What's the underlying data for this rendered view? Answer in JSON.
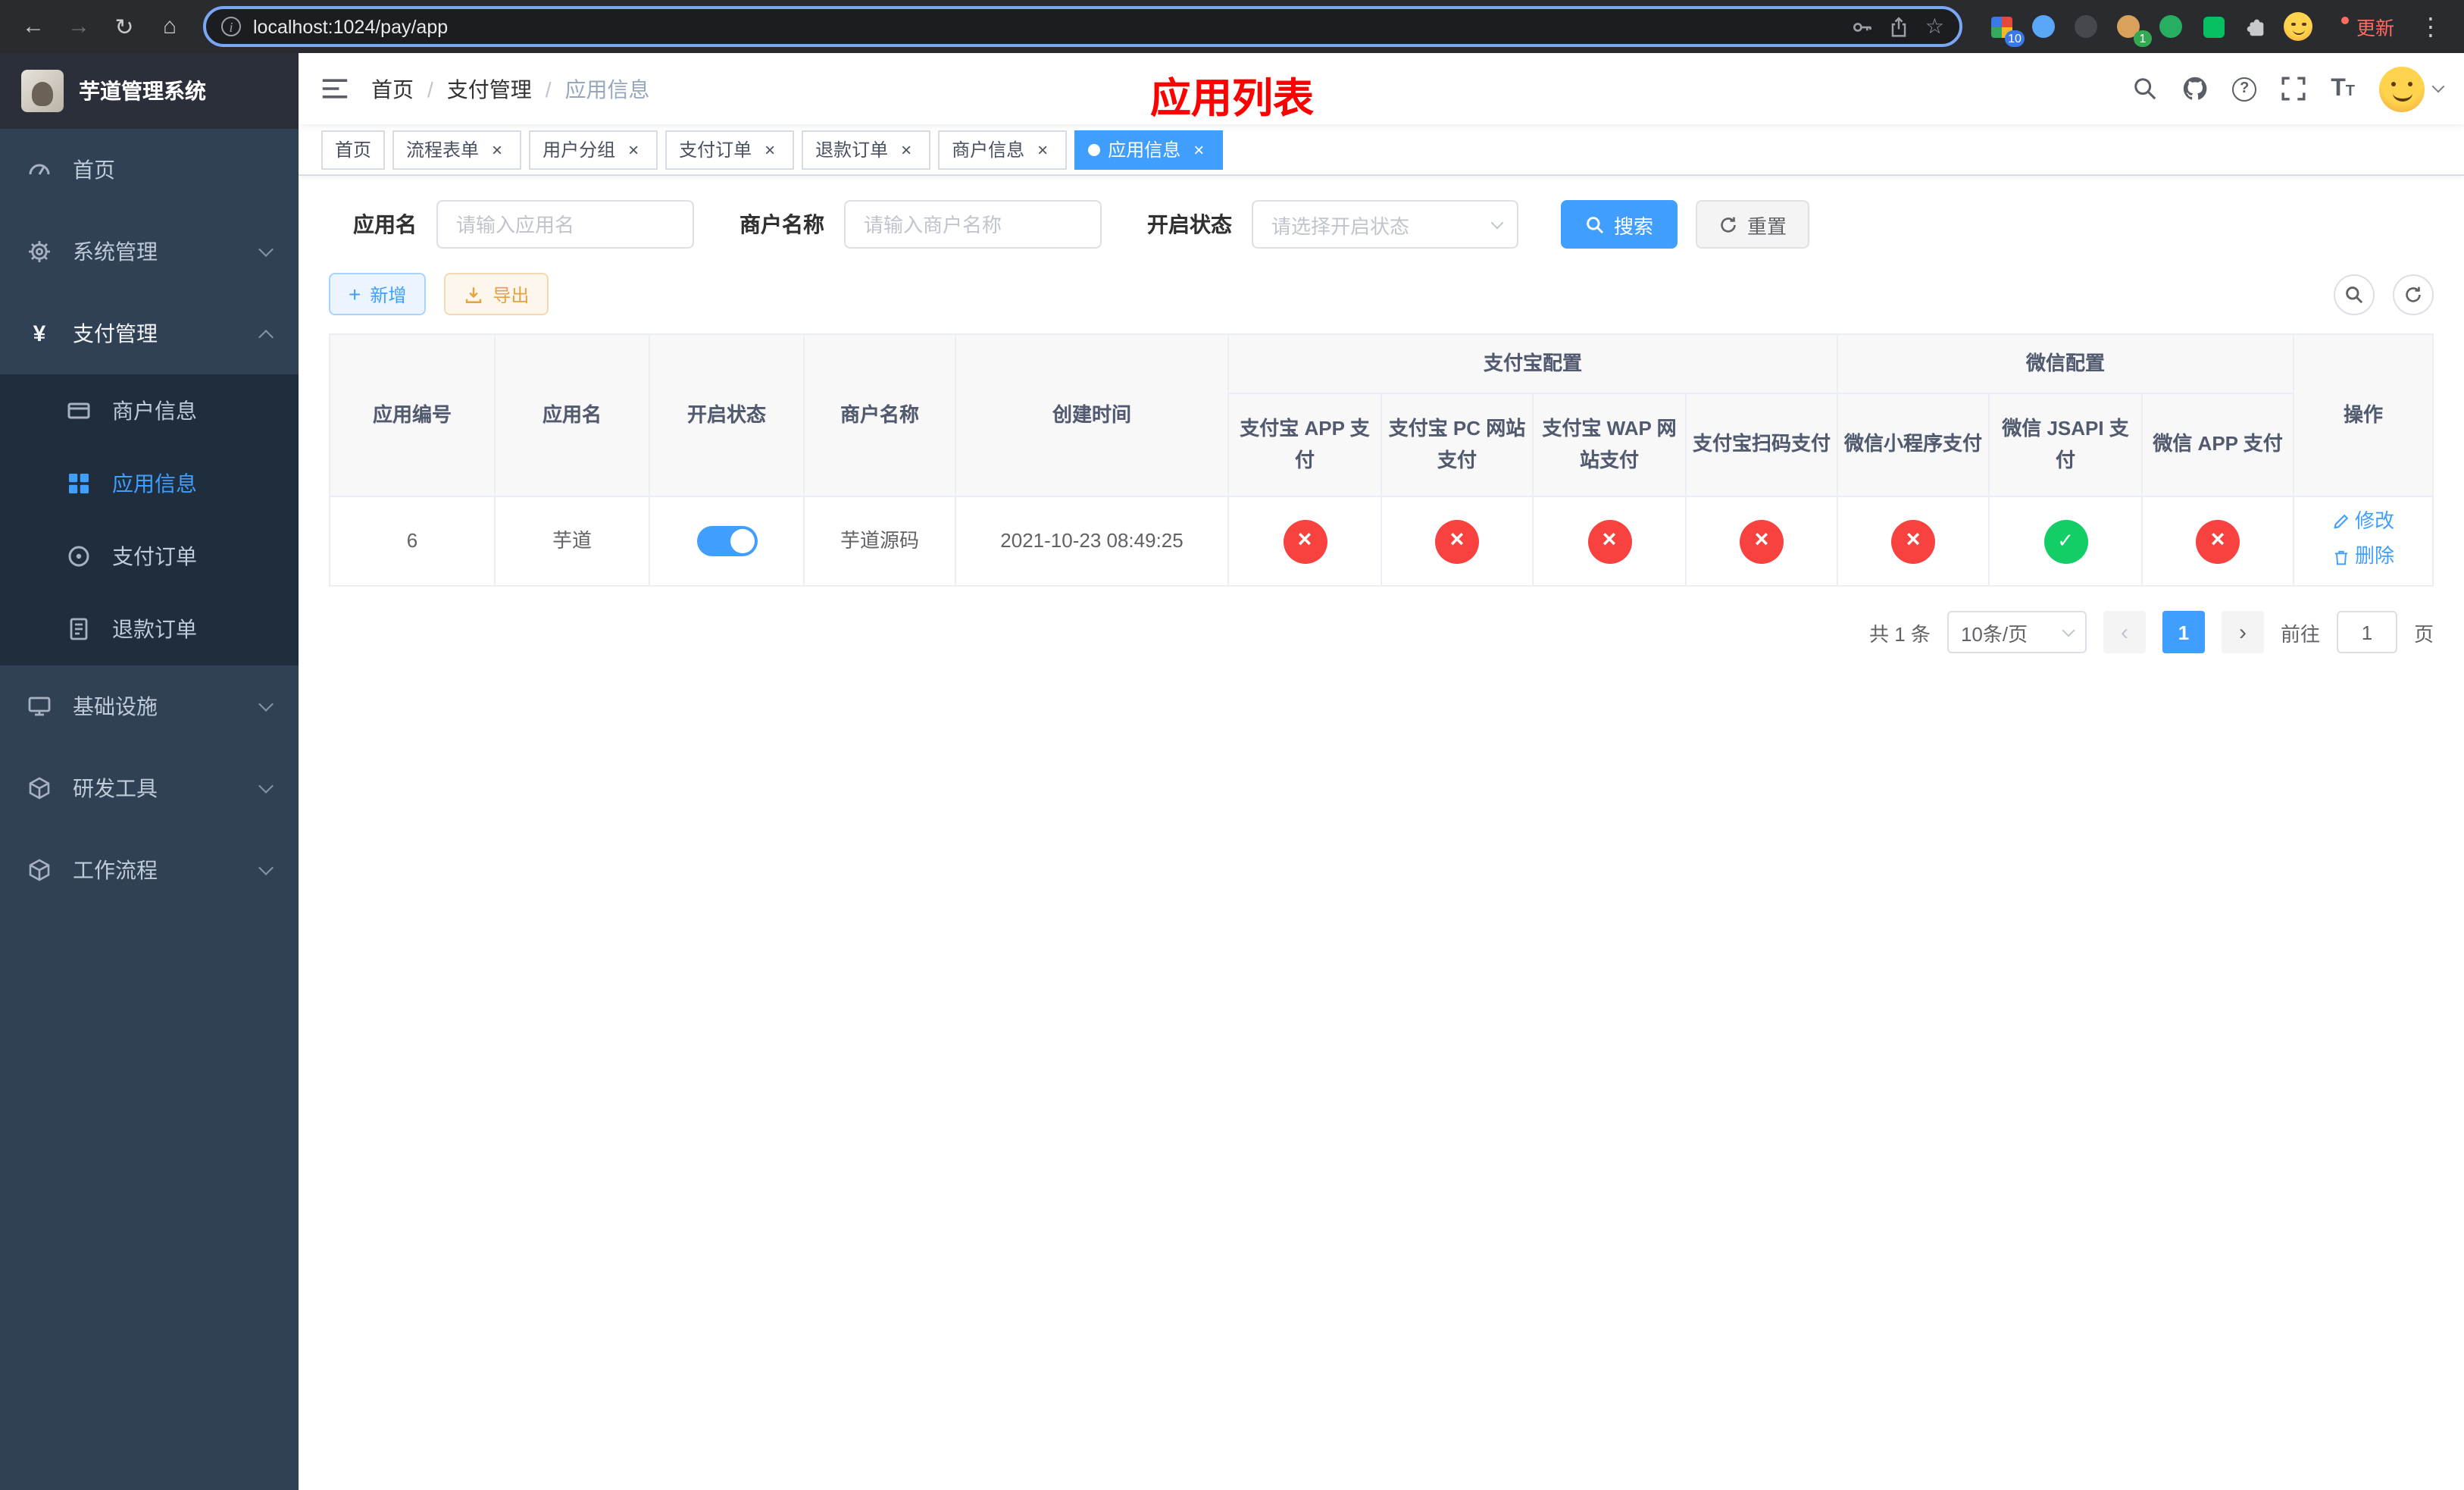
{
  "colors": {
    "accent": "#409eff",
    "danger": "#f8423f",
    "success": "#13ce66",
    "page_title": "#ff0000",
    "sidebar_bg": "#304156",
    "submenu_bg": "#1f2d3d"
  },
  "browser": {
    "url": "localhost:1024/pay/app",
    "update_label": "更新",
    "extensions_badge": "10",
    "profile_badge": "1"
  },
  "sidebar": {
    "logo_title": "芋道管理系统",
    "items": [
      {
        "label": "首页",
        "icon": "dashboard-icon"
      },
      {
        "label": "系统管理",
        "icon": "gear-icon"
      },
      {
        "label": "支付管理",
        "icon": "yen-icon"
      },
      {
        "label": "商户信息",
        "icon": "credit-card-icon"
      },
      {
        "label": "应用信息",
        "icon": "app-grid-icon"
      },
      {
        "label": "支付订单",
        "icon": "order-icon"
      },
      {
        "label": "退款订单",
        "icon": "refund-doc-icon"
      },
      {
        "label": "基础设施",
        "icon": "monitor-icon"
      },
      {
        "label": "研发工具",
        "icon": "cube-icon"
      },
      {
        "label": "工作流程",
        "icon": "cube-icon"
      }
    ]
  },
  "header": {
    "breadcrumb": [
      "首页",
      "支付管理",
      "应用信息"
    ],
    "separator": "/",
    "page_title": "应用列表",
    "action_icons": [
      "search-icon",
      "github-icon",
      "help-icon",
      "fullscreen-icon",
      "font-size-icon",
      "user-avatar"
    ]
  },
  "tabs": [
    {
      "label": "首页"
    },
    {
      "label": "流程表单"
    },
    {
      "label": "用户分组"
    },
    {
      "label": "支付订单"
    },
    {
      "label": "退款订单"
    },
    {
      "label": "商户信息"
    },
    {
      "label": "应用信息"
    }
  ],
  "filters": {
    "app_name_label": "应用名",
    "app_name_placeholder": "请输入应用名",
    "merchant_label": "商户名称",
    "merchant_placeholder": "请输入商户名称",
    "status_label": "开启状态",
    "status_placeholder": "请选择开启状态",
    "search_label": "搜索",
    "reset_label": "重置"
  },
  "toolbar": {
    "add_label": "新增",
    "add_icon": "plus-icon",
    "export_label": "导出",
    "export_icon": "download-icon"
  },
  "table": {
    "headers": {
      "app_id": "应用编号",
      "app_name": "应用名",
      "status": "开启状态",
      "merchant_name": "商户名称",
      "created_at": "创建时间",
      "alipay_group": "支付宝配置",
      "wechat_group": "微信配置",
      "alipay_cols": [
        "支付宝 APP 支付",
        "支付宝 PC 网站支付",
        "支付宝 WAP 网站支付",
        "支付宝扫码支付"
      ],
      "wechat_cols": [
        "微信小程序支付",
        "微信 JSAPI 支付",
        "微信 APP 支付"
      ],
      "actions": "操作"
    },
    "rows": [
      {
        "app_id": "6",
        "app_name": "芋道",
        "status_on": true,
        "merchant_name": "芋道源码",
        "created_at": "2021-10-23 08:49:25",
        "alipay": [
          false,
          false,
          false,
          false
        ],
        "wechat": [
          false,
          true,
          false
        ],
        "edit_label": "修改",
        "delete_label": "删除"
      }
    ]
  },
  "pagination": {
    "total_label": "共 1 条",
    "page_size_label": "10条/页",
    "current_page": "1",
    "goto_label": "前往",
    "goto_value": "1",
    "page_unit_label": "页"
  }
}
